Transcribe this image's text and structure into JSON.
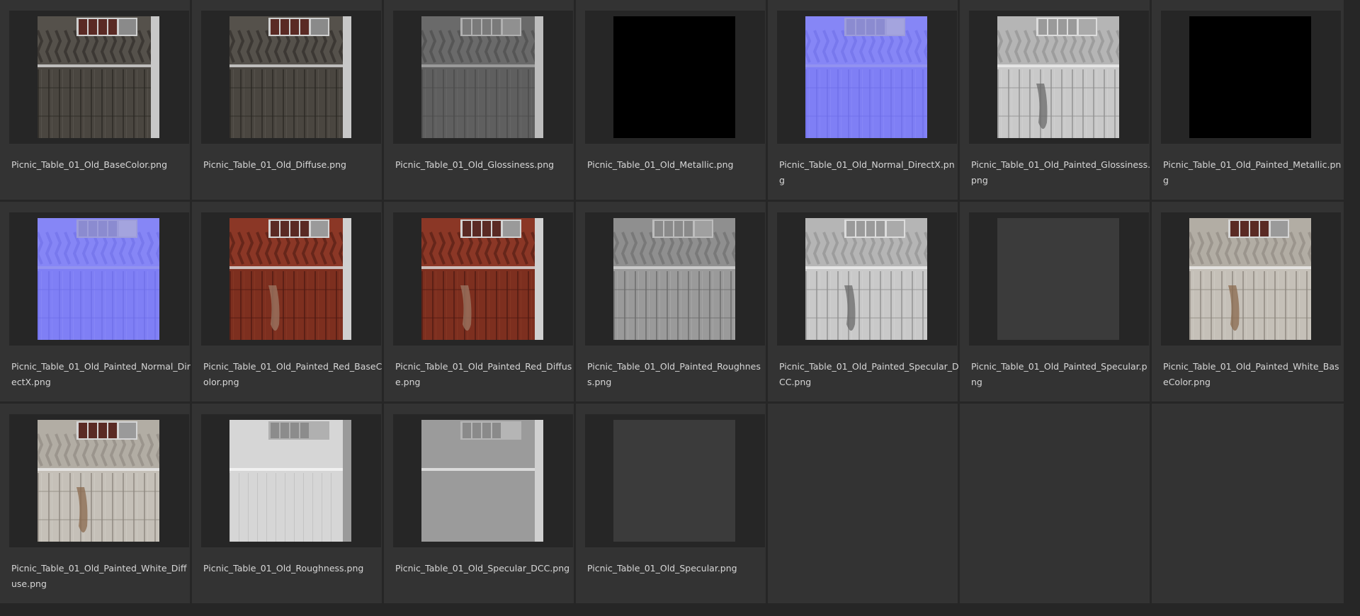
{
  "files": [
    {
      "name": "Picnic_Table_01_Old_BaseColor.png",
      "texture": "wood-dark"
    },
    {
      "name": "Picnic_Table_01_Old_Diffuse.png",
      "texture": "wood-dark"
    },
    {
      "name": "Picnic_Table_01_Old_Glossiness.png",
      "texture": "gray-gloss"
    },
    {
      "name": "Picnic_Table_01_Old_Metallic.png",
      "texture": "black"
    },
    {
      "name": "Picnic_Table_01_Old_Normal_DirectX.png",
      "texture": "normal"
    },
    {
      "name": "Picnic_Table_01_Old_Painted_Glossiness.png",
      "texture": "light-gray-wood"
    },
    {
      "name": "Picnic_Table_01_Old_Painted_Metallic.png",
      "texture": "black"
    },
    {
      "name": "Picnic_Table_01_Old_Painted_Normal_DirectX.png",
      "texture": "normal"
    },
    {
      "name": "Picnic_Table_01_Old_Painted_Red_BaseColor.png",
      "texture": "red-wood"
    },
    {
      "name": "Picnic_Table_01_Old_Painted_Red_Diffuse.png",
      "texture": "red-wood"
    },
    {
      "name": "Picnic_Table_01_Old_Painted_Roughness.png",
      "texture": "mid-gray-wood"
    },
    {
      "name": "Picnic_Table_01_Old_Painted_Specular_DCC.png",
      "texture": "light-gray-wood"
    },
    {
      "name": "Picnic_Table_01_Old_Painted_Specular.png",
      "texture": "flat-dark"
    },
    {
      "name": "Picnic_Table_01_Old_Painted_White_BaseColor.png",
      "texture": "white-wood"
    },
    {
      "name": "Picnic_Table_01_Old_Painted_White_Diffuse.png",
      "texture": "white-wood"
    },
    {
      "name": "Picnic_Table_01_Old_Roughness.png",
      "texture": "light-plain"
    },
    {
      "name": "Picnic_Table_01_Old_Specular_DCC.png",
      "texture": "gray-plain"
    },
    {
      "name": "Picnic_Table_01_Old_Specular.png",
      "texture": "flat-dark"
    }
  ],
  "colors": {
    "background": "#333333",
    "divider": "#262626",
    "label": "#d7d7d7"
  }
}
